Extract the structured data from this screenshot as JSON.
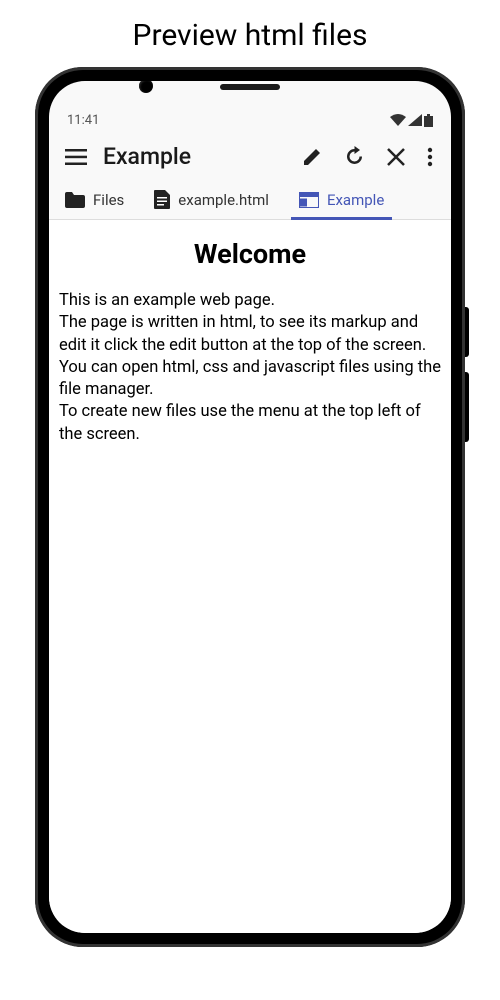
{
  "page_caption": "Preview html files",
  "status": {
    "time": "11:41"
  },
  "appbar": {
    "title": "Example"
  },
  "tabs": [
    {
      "label": "Files"
    },
    {
      "label": "example.html"
    },
    {
      "label": "Example"
    }
  ],
  "active_tab_index": 2,
  "accent_color": "#4456b6",
  "content": {
    "heading": "Welcome",
    "paragraphs": [
      "This is an example web page.",
      "The page is written in html, to see its markup and edit it click the edit button at the top of the screen.",
      "You can open html, css and javascript files using the file manager.",
      "To create new files use the menu at the top left of the screen."
    ]
  }
}
